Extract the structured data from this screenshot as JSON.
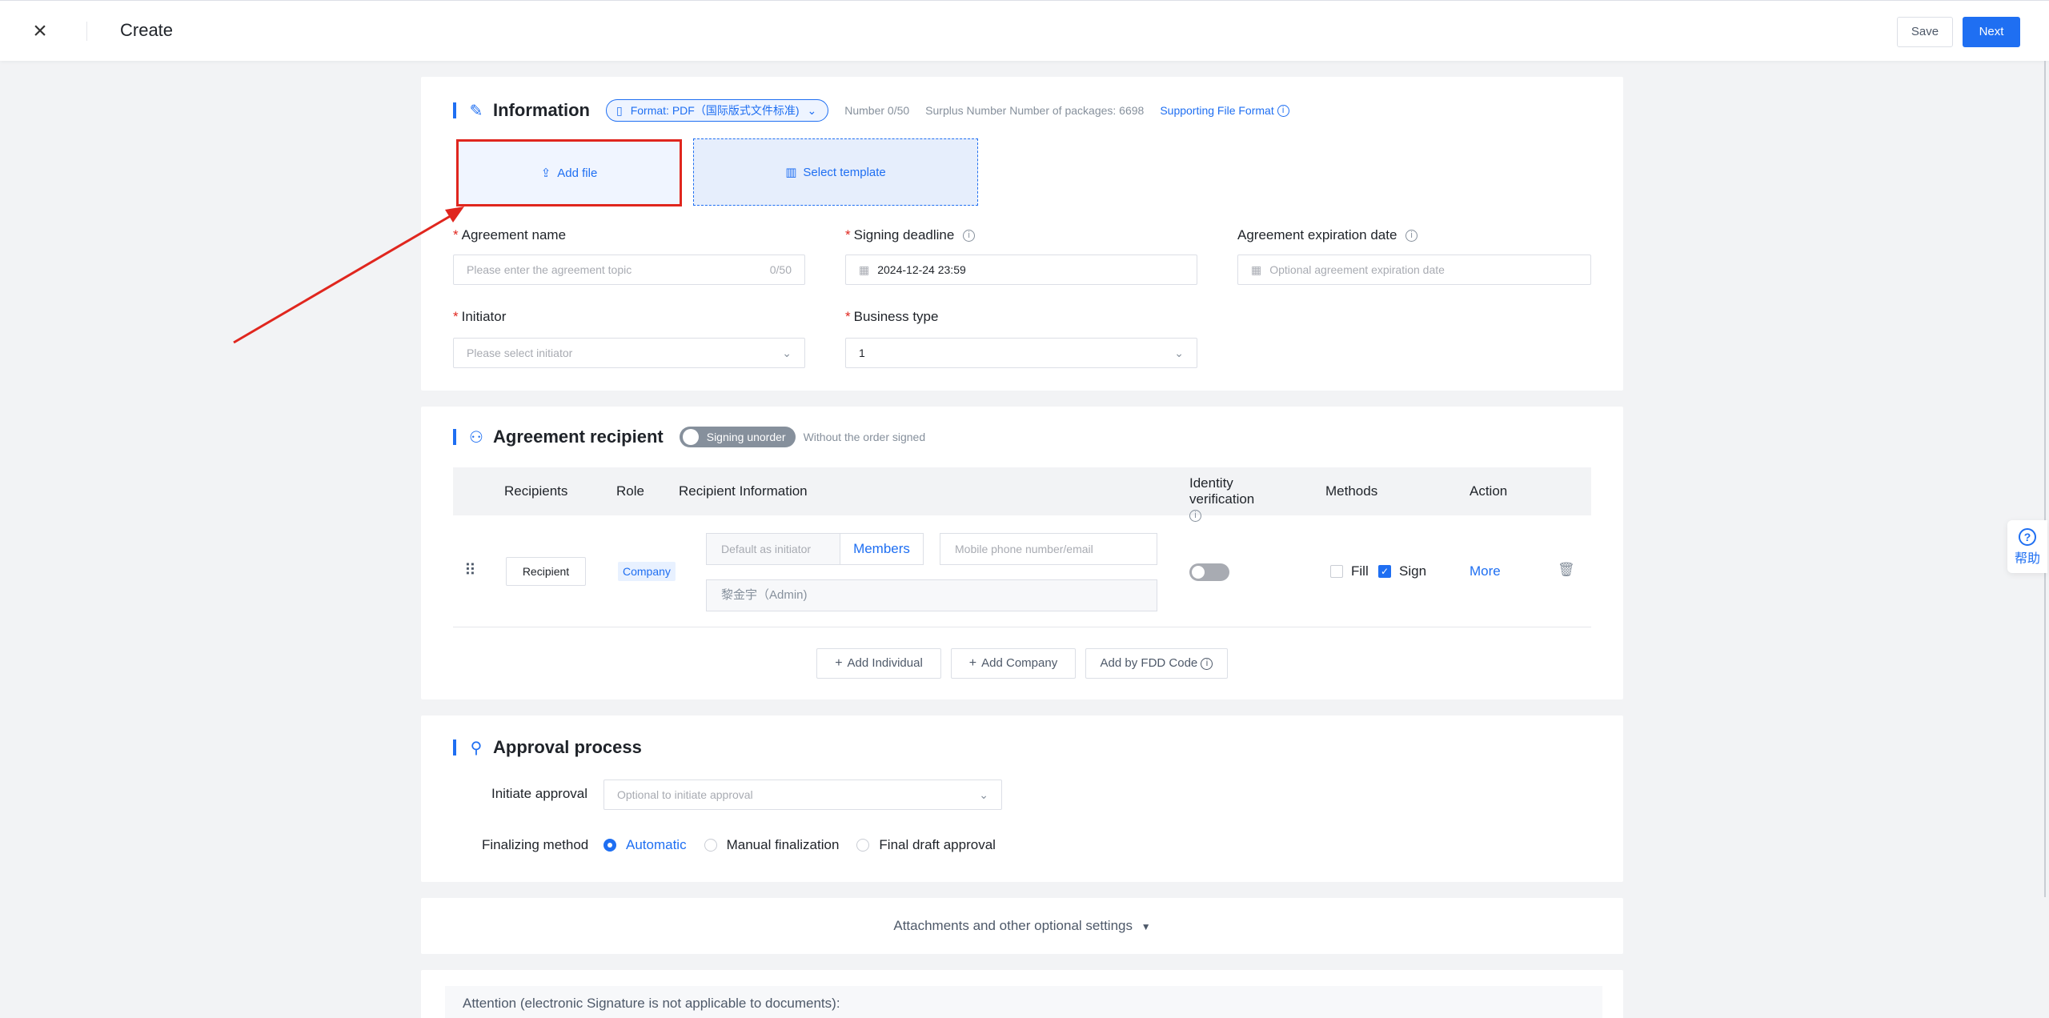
{
  "header": {
    "close_icon": "×",
    "title": "Create",
    "save_label": "Save",
    "next_label": "Next"
  },
  "help": {
    "icon": "?",
    "label": "帮助"
  },
  "information": {
    "title": "Information",
    "format_label": "Format: PDF（国际版式文件标准)",
    "number": "Number 0/50",
    "surplus": "Surplus Number Number of packages: 6698",
    "supporting_format": "Supporting File Format",
    "add_file": "Add file",
    "select_template": "Select template",
    "fields": {
      "agreement_name": {
        "label": "Agreement name",
        "placeholder": "Please enter the agreement topic",
        "counter": "0/50"
      },
      "signing_deadline": {
        "label": "Signing deadline",
        "value": "2024-12-24 23:59"
      },
      "expiration": {
        "label": "Agreement expiration date",
        "placeholder": "Optional agreement expiration date"
      },
      "initiator": {
        "label": "Initiator",
        "placeholder": "Please select initiator"
      },
      "business_type": {
        "label": "Business type",
        "value": "1"
      }
    }
  },
  "recipient": {
    "title": "Agreement recipient",
    "toggle_label": "Signing unorder",
    "toggle_hint": "Without the order signed",
    "columns": [
      "Recipients",
      "Role",
      "Recipient Information",
      "Identity verification",
      "Methods",
      "Action"
    ],
    "row": {
      "recipient_label": "Recipient",
      "role": "Company",
      "default_placeholder": "Default as initiator",
      "members_label": "Members",
      "mobile_placeholder": "Mobile phone number/email",
      "admin_value": "黎金宇（Admin)",
      "identity_verification": false,
      "fill_label": "Fill",
      "fill_checked": false,
      "sign_label": "Sign",
      "sign_checked": true,
      "more_label": "More"
    },
    "buttons": {
      "add_individual": "Add Individual",
      "add_company": "Add Company",
      "add_fdd": "Add by FDD Code"
    }
  },
  "approval": {
    "title": "Approval process",
    "initiate_label": "Initiate approval",
    "initiate_placeholder": "Optional to initiate approval",
    "finalizing_label": "Finalizing method",
    "options": [
      "Automatic",
      "Manual finalization",
      "Final draft approval"
    ],
    "selected": "Automatic"
  },
  "attachments": {
    "label": "Attachments and other optional settings"
  },
  "attention": {
    "text": "Attention (electronic Signature is not applicable to documents):"
  },
  "colors": {
    "accent": "#1f6ff2",
    "highlight_box": "#e0261e",
    "annotation_arrow": "#e0261e"
  }
}
